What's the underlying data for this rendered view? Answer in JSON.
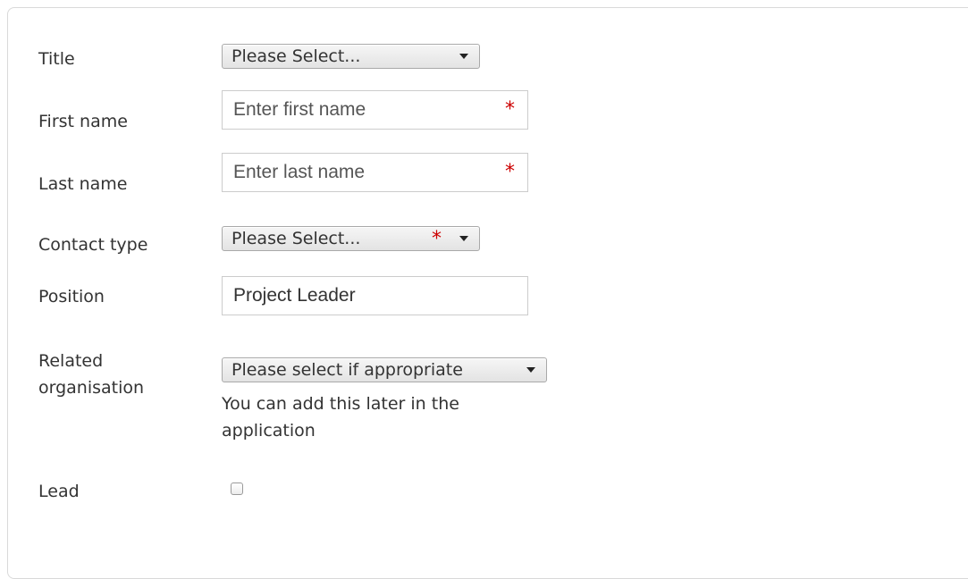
{
  "form": {
    "title": {
      "label": "Title",
      "selected": "Please Select..."
    },
    "first_name": {
      "label": "First name",
      "placeholder": "Enter first name",
      "value": "",
      "required_mark": "*"
    },
    "last_name": {
      "label": "Last name",
      "placeholder": "Enter last name",
      "value": "",
      "required_mark": "*"
    },
    "contact_type": {
      "label": "Contact type",
      "selected": "Please Select...",
      "required_mark": "*"
    },
    "position": {
      "label": "Position",
      "value": "Project Leader"
    },
    "related_organisation": {
      "label": "Related organisation",
      "selected": "Please select if appropriate",
      "help_text": "You can add this later in the application"
    },
    "lead": {
      "label": "Lead",
      "checked": false
    }
  },
  "colors": {
    "required": "#cc0000",
    "border": "#cccccc",
    "text": "#333333"
  }
}
